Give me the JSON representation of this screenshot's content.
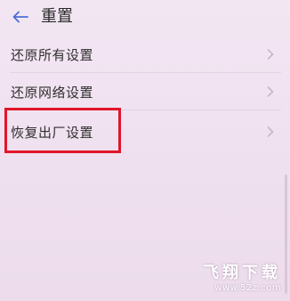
{
  "header": {
    "back_icon": "arrow-left-icon",
    "title": "重置"
  },
  "settings": {
    "items": [
      {
        "label": "还原所有设置",
        "icon": "chevron-right-icon"
      },
      {
        "label": "还原网络设置",
        "icon": "chevron-right-icon"
      },
      {
        "label": "恢复出厂设置",
        "icon": "chevron-right-icon"
      }
    ]
  },
  "annotation": {
    "highlight_color": "#e1152a"
  },
  "watermark": {
    "title": "飞翔下载",
    "url": "www.52z.com"
  },
  "colors": {
    "accent": "#4a6fd8",
    "background": "#f1e4f1"
  }
}
